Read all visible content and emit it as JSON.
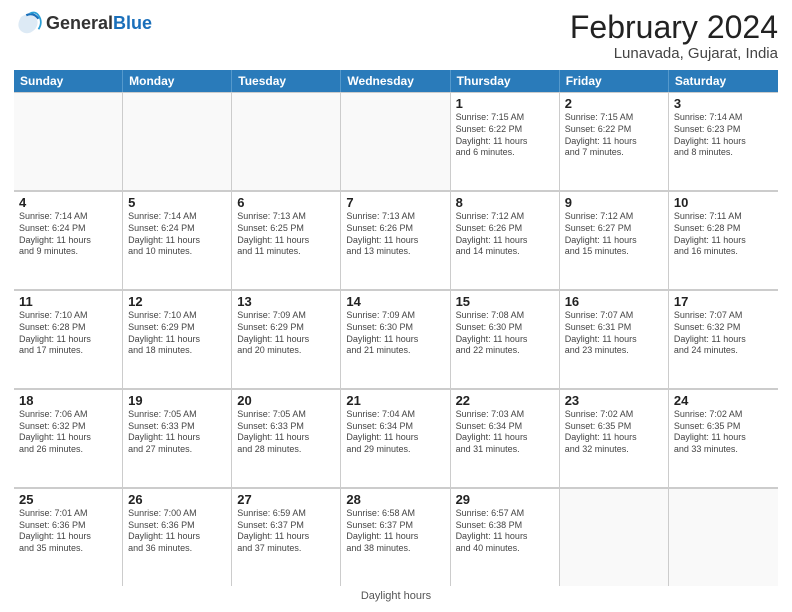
{
  "header": {
    "logo_general": "General",
    "logo_blue": "Blue",
    "month_title": "February 2024",
    "subtitle": "Lunavada, Gujarat, India"
  },
  "days_of_week": [
    "Sunday",
    "Monday",
    "Tuesday",
    "Wednesday",
    "Thursday",
    "Friday",
    "Saturday"
  ],
  "footer": "Daylight hours",
  "weeks": [
    [
      {
        "num": "",
        "info": ""
      },
      {
        "num": "",
        "info": ""
      },
      {
        "num": "",
        "info": ""
      },
      {
        "num": "",
        "info": ""
      },
      {
        "num": "1",
        "info": "Sunrise: 7:15 AM\nSunset: 6:22 PM\nDaylight: 11 hours\nand 6 minutes."
      },
      {
        "num": "2",
        "info": "Sunrise: 7:15 AM\nSunset: 6:22 PM\nDaylight: 11 hours\nand 7 minutes."
      },
      {
        "num": "3",
        "info": "Sunrise: 7:14 AM\nSunset: 6:23 PM\nDaylight: 11 hours\nand 8 minutes."
      }
    ],
    [
      {
        "num": "4",
        "info": "Sunrise: 7:14 AM\nSunset: 6:24 PM\nDaylight: 11 hours\nand 9 minutes."
      },
      {
        "num": "5",
        "info": "Sunrise: 7:14 AM\nSunset: 6:24 PM\nDaylight: 11 hours\nand 10 minutes."
      },
      {
        "num": "6",
        "info": "Sunrise: 7:13 AM\nSunset: 6:25 PM\nDaylight: 11 hours\nand 11 minutes."
      },
      {
        "num": "7",
        "info": "Sunrise: 7:13 AM\nSunset: 6:26 PM\nDaylight: 11 hours\nand 13 minutes."
      },
      {
        "num": "8",
        "info": "Sunrise: 7:12 AM\nSunset: 6:26 PM\nDaylight: 11 hours\nand 14 minutes."
      },
      {
        "num": "9",
        "info": "Sunrise: 7:12 AM\nSunset: 6:27 PM\nDaylight: 11 hours\nand 15 minutes."
      },
      {
        "num": "10",
        "info": "Sunrise: 7:11 AM\nSunset: 6:28 PM\nDaylight: 11 hours\nand 16 minutes."
      }
    ],
    [
      {
        "num": "11",
        "info": "Sunrise: 7:10 AM\nSunset: 6:28 PM\nDaylight: 11 hours\nand 17 minutes."
      },
      {
        "num": "12",
        "info": "Sunrise: 7:10 AM\nSunset: 6:29 PM\nDaylight: 11 hours\nand 18 minutes."
      },
      {
        "num": "13",
        "info": "Sunrise: 7:09 AM\nSunset: 6:29 PM\nDaylight: 11 hours\nand 20 minutes."
      },
      {
        "num": "14",
        "info": "Sunrise: 7:09 AM\nSunset: 6:30 PM\nDaylight: 11 hours\nand 21 minutes."
      },
      {
        "num": "15",
        "info": "Sunrise: 7:08 AM\nSunset: 6:30 PM\nDaylight: 11 hours\nand 22 minutes."
      },
      {
        "num": "16",
        "info": "Sunrise: 7:07 AM\nSunset: 6:31 PM\nDaylight: 11 hours\nand 23 minutes."
      },
      {
        "num": "17",
        "info": "Sunrise: 7:07 AM\nSunset: 6:32 PM\nDaylight: 11 hours\nand 24 minutes."
      }
    ],
    [
      {
        "num": "18",
        "info": "Sunrise: 7:06 AM\nSunset: 6:32 PM\nDaylight: 11 hours\nand 26 minutes."
      },
      {
        "num": "19",
        "info": "Sunrise: 7:05 AM\nSunset: 6:33 PM\nDaylight: 11 hours\nand 27 minutes."
      },
      {
        "num": "20",
        "info": "Sunrise: 7:05 AM\nSunset: 6:33 PM\nDaylight: 11 hours\nand 28 minutes."
      },
      {
        "num": "21",
        "info": "Sunrise: 7:04 AM\nSunset: 6:34 PM\nDaylight: 11 hours\nand 29 minutes."
      },
      {
        "num": "22",
        "info": "Sunrise: 7:03 AM\nSunset: 6:34 PM\nDaylight: 11 hours\nand 31 minutes."
      },
      {
        "num": "23",
        "info": "Sunrise: 7:02 AM\nSunset: 6:35 PM\nDaylight: 11 hours\nand 32 minutes."
      },
      {
        "num": "24",
        "info": "Sunrise: 7:02 AM\nSunset: 6:35 PM\nDaylight: 11 hours\nand 33 minutes."
      }
    ],
    [
      {
        "num": "25",
        "info": "Sunrise: 7:01 AM\nSunset: 6:36 PM\nDaylight: 11 hours\nand 35 minutes."
      },
      {
        "num": "26",
        "info": "Sunrise: 7:00 AM\nSunset: 6:36 PM\nDaylight: 11 hours\nand 36 minutes."
      },
      {
        "num": "27",
        "info": "Sunrise: 6:59 AM\nSunset: 6:37 PM\nDaylight: 11 hours\nand 37 minutes."
      },
      {
        "num": "28",
        "info": "Sunrise: 6:58 AM\nSunset: 6:37 PM\nDaylight: 11 hours\nand 38 minutes."
      },
      {
        "num": "29",
        "info": "Sunrise: 6:57 AM\nSunset: 6:38 PM\nDaylight: 11 hours\nand 40 minutes."
      },
      {
        "num": "",
        "info": ""
      },
      {
        "num": "",
        "info": ""
      }
    ]
  ]
}
